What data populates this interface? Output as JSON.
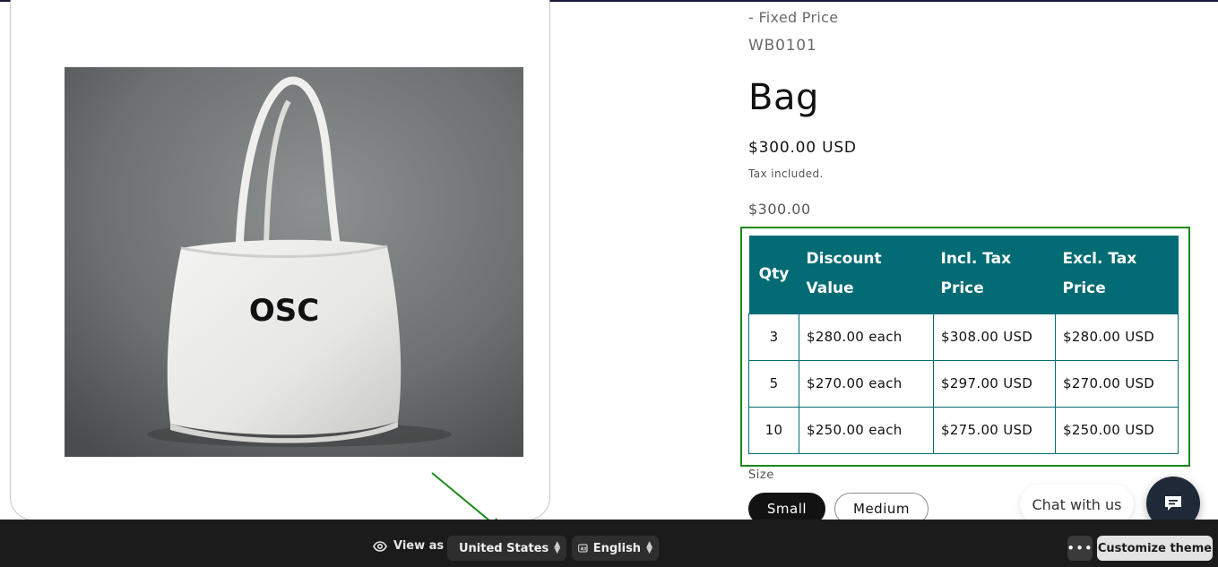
{
  "product": {
    "vendor_line": "- Fixed Price",
    "sku": "WB0101",
    "title": "Bag",
    "price": "$300.00 USD",
    "tax_note": "Tax included.",
    "unit_price": "$300.00",
    "image_logo_text": "OSC"
  },
  "discount_table": {
    "headers": {
      "qty": "Qty",
      "discount_line1": "Discount",
      "discount_line2": "Value",
      "incl_line1": "Incl. Tax",
      "incl_line2": "Price",
      "excl_line1": "Excl. Tax",
      "excl_line2": "Price"
    },
    "rows": [
      {
        "qty": "3",
        "discount": "$280.00 each",
        "incl": "$308.00 USD",
        "excl": "$280.00 USD"
      },
      {
        "qty": "5",
        "discount": "$270.00 each",
        "incl": "$297.00 USD",
        "excl": "$270.00 USD"
      },
      {
        "qty": "10",
        "discount": "$250.00 each",
        "incl": "$275.00 USD",
        "excl": "$250.00 USD"
      }
    ],
    "header_color": "#036b73",
    "highlight_color": "#1a8a1a"
  },
  "size": {
    "label": "Size",
    "options": [
      "Small",
      "Medium"
    ],
    "selected": "Small"
  },
  "chat": {
    "label": "Chat with us",
    "icon": "chat-bubble-icon"
  },
  "preview_bar": {
    "view_as_label": "View as",
    "country": "United States",
    "language": "English",
    "more_icon": "ellipsis-icon",
    "customize_label": "Customize theme"
  }
}
